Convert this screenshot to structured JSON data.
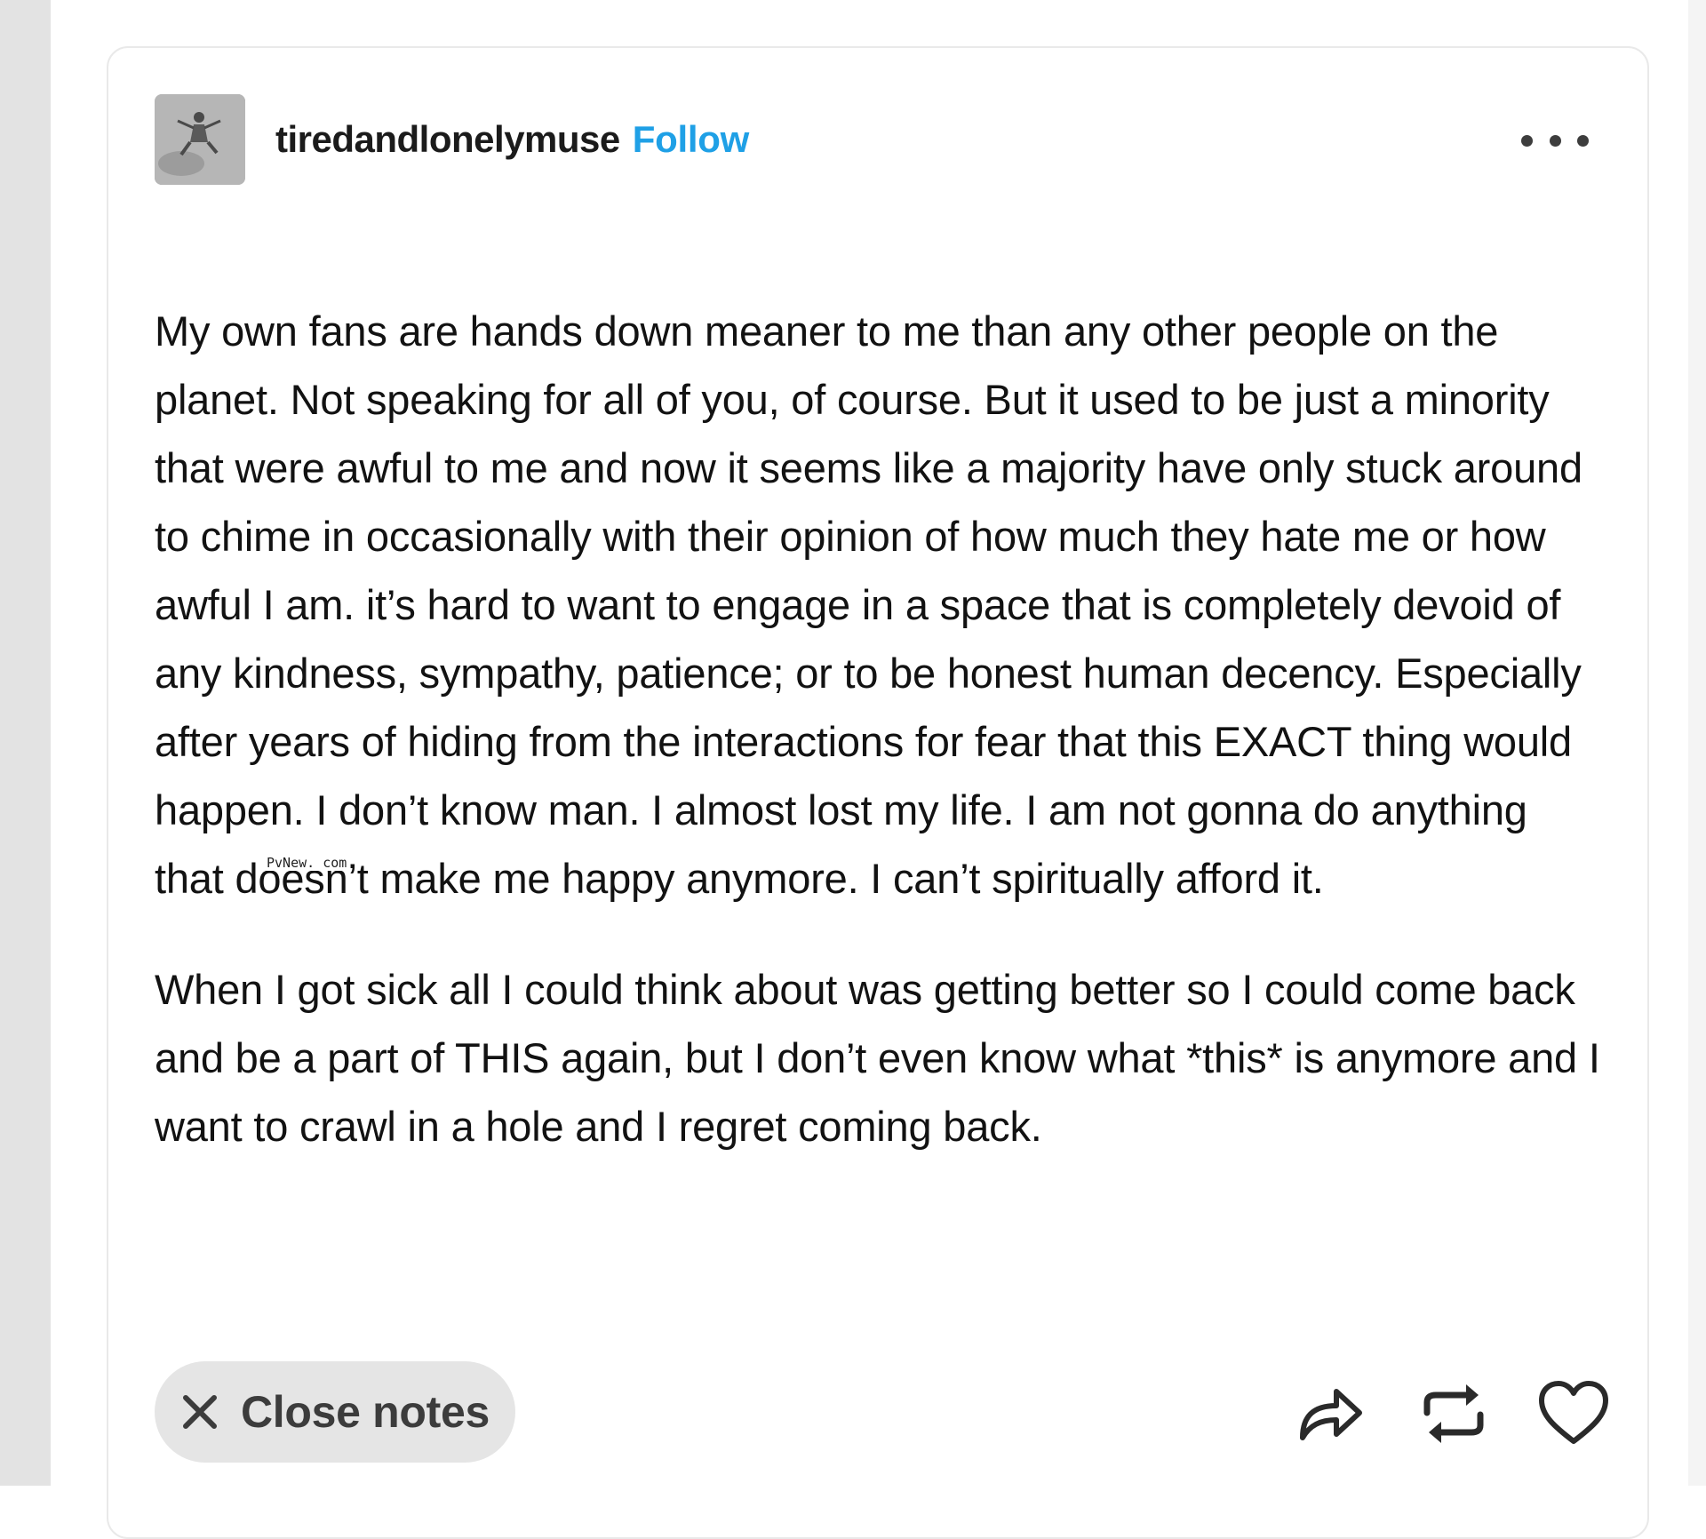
{
  "post": {
    "username": "tiredandlonelymuse",
    "follow_label": "Follow",
    "more_options_icon": "ellipsis-horizontal-icon",
    "paragraphs": [
      "My own fans are hands down meaner to me than any other people on the planet. Not speaking for all of you, of course. But it used to be just a minority that were awful to me and now it seems like a majority have only stuck around to chime in occasionally with their opinion of how much they hate me or how awful I am. it’s hard to want to engage in a space that is completely devoid of any kindness, sympathy, patience; or to be honest human decency. Especially after years of hiding from the interactions for fear that this EXACT thing would happen. I don’t know man. I almost lost my life. I am not gonna do anything that doesn’t make me happy anymore. I can’t spiritually afford it.",
      "When I got sick all I could think about was getting better so I could come back and be a part of THIS again, but I don’t even know what *this* is anymore and I want to crawl in a hole and I regret coming back."
    ]
  },
  "watermark": "PvNew. com",
  "footer": {
    "close_notes_label": "Close notes",
    "close_icon": "close-x-icon",
    "actions": [
      "share-icon",
      "reblog-icon",
      "like-heart-icon"
    ]
  },
  "colors": {
    "follow": "#1fa0e6",
    "text": "#121212",
    "pill_background": "#e5e5e5",
    "left_strip": "#e3e3e3"
  }
}
